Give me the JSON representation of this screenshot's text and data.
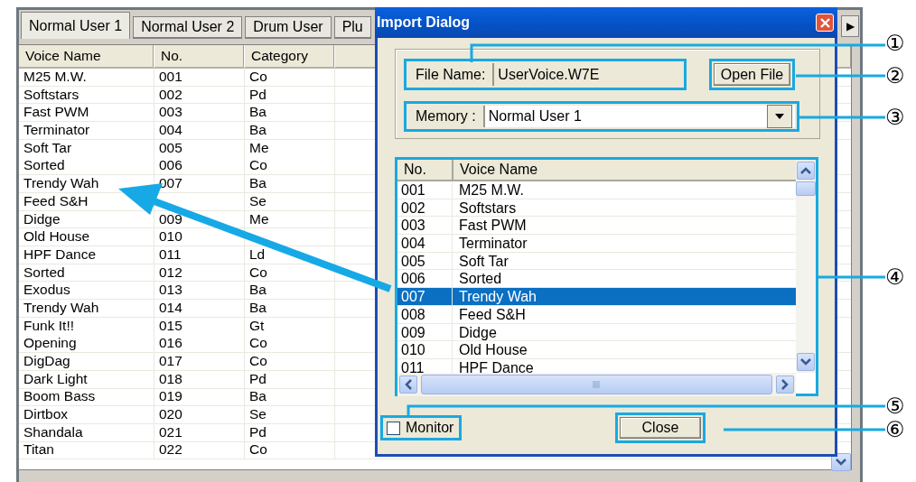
{
  "main_window": {
    "tabs": [
      {
        "label": "Normal User 1",
        "selected": true
      },
      {
        "label": "Normal User 2",
        "selected": false
      },
      {
        "label": "Drum User",
        "selected": false
      },
      {
        "label": "Plu",
        "selected": false
      }
    ],
    "table": {
      "columns": [
        "Voice Name",
        "No.",
        "Category"
      ],
      "rows": [
        [
          "M25  M.W.",
          "001",
          "Co"
        ],
        [
          "Softstars",
          "002",
          "Pd"
        ],
        [
          "Fast PWM",
          "003",
          "Ba"
        ],
        [
          "Terminator",
          "004",
          "Ba"
        ],
        [
          "Soft Tar",
          "005",
          "Me"
        ],
        [
          "Sorted",
          "006",
          "Co"
        ],
        [
          "Trendy Wah",
          "007",
          "Ba"
        ],
        {
          "voice_name": "Feed S&H",
          "category": "Se"
        },
        [
          "Didge",
          "009",
          "Me"
        ],
        {
          "voice_name": "Old House",
          "no": "010"
        },
        [
          "HPF Dance",
          "011",
          "Ld"
        ],
        [
          "Sorted",
          "012",
          "Co"
        ],
        [
          "Exodus",
          "013",
          "Ba"
        ],
        [
          "Trendy Wah",
          "014",
          "Ba"
        ],
        [
          "Funk It!!",
          "015",
          "Gt"
        ],
        [
          "Opening",
          "016",
          "Co"
        ],
        [
          "DigDag",
          "017",
          "Co"
        ],
        [
          "Dark Light",
          "018",
          "Pd"
        ],
        [
          "Boom Bass",
          "019",
          "Ba"
        ],
        [
          "Dirtbox",
          "020",
          "Se"
        ],
        [
          "Shandala",
          "021",
          "Pd"
        ],
        [
          "Titan",
          "022",
          "Co"
        ]
      ]
    },
    "tab_scroll_button": "▶"
  },
  "dialog": {
    "title": "Import Dialog",
    "file_name": {
      "label": "File Name:",
      "value": "UserVoice.W7E"
    },
    "open_button": "Open File",
    "memory": {
      "label": "Memory :",
      "value": "Normal User 1"
    },
    "list": {
      "columns": [
        "No.",
        "Voice Name"
      ],
      "rows": [
        {
          "no": "001",
          "name": "M25  M.W.",
          "selected": false
        },
        {
          "no": "002",
          "name": "Softstars",
          "selected": false
        },
        {
          "no": "003",
          "name": "Fast PWM",
          "selected": false
        },
        {
          "no": "004",
          "name": "Terminator",
          "selected": false
        },
        {
          "no": "005",
          "name": "Soft Tar",
          "selected": false
        },
        {
          "no": "006",
          "name": "Sorted",
          "selected": false
        },
        {
          "no": "007",
          "name": "Trendy Wah",
          "selected": true
        },
        {
          "no": "008",
          "name": "Feed S&H",
          "selected": false
        },
        {
          "no": "009",
          "name": "Didge",
          "selected": false
        },
        {
          "no": "010",
          "name": "Old House",
          "selected": false
        },
        {
          "no": "011",
          "name": "HPF Dance",
          "selected": false
        }
      ]
    },
    "monitor": {
      "label": "Monitor",
      "checked": false
    },
    "close_button": "Close"
  },
  "callouts": [
    "①",
    "②",
    "③",
    "④",
    "⑤",
    "⑥"
  ]
}
